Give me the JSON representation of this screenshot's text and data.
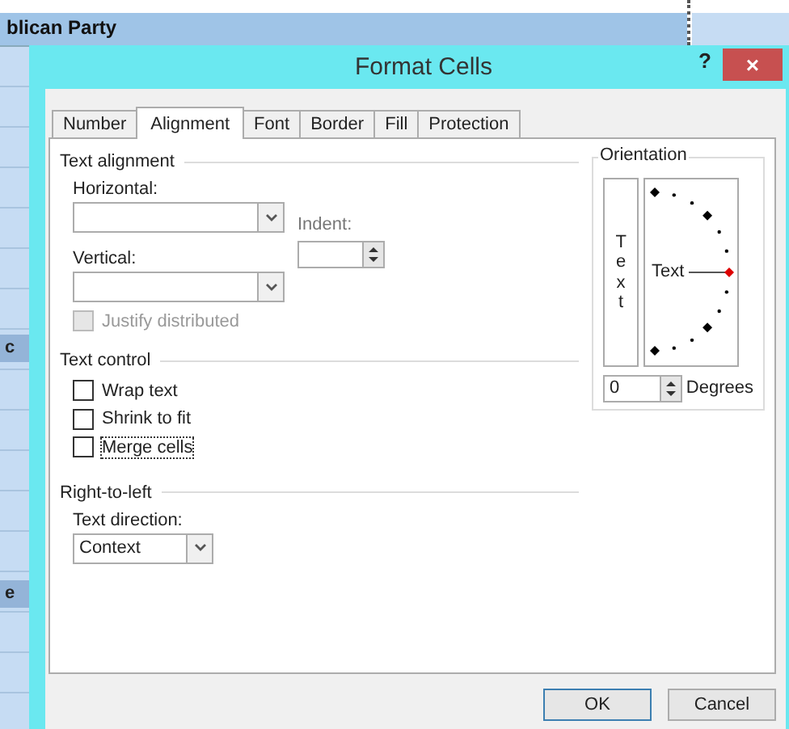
{
  "sheet": {
    "header_cell": "blican Party",
    "side_cells": [
      "c",
      "e"
    ]
  },
  "dialog": {
    "title": "Format Cells",
    "help": "?",
    "close": "×",
    "tabs": [
      {
        "label": "Number",
        "selected": false
      },
      {
        "label": "Alignment",
        "selected": true
      },
      {
        "label": "Font",
        "selected": false
      },
      {
        "label": "Border",
        "selected": false
      },
      {
        "label": "Fill",
        "selected": false
      },
      {
        "label": "Protection",
        "selected": false
      }
    ],
    "text_alignment": {
      "title": "Text alignment",
      "horizontal_label": "Horizontal:",
      "vertical_label": "Vertical:",
      "indent_label": "Indent:",
      "justify_distributed": {
        "label": "Justify distributed",
        "checked": false,
        "disabled": true
      }
    },
    "text_control": {
      "title": "Text control",
      "options": [
        {
          "label": "Wrap text",
          "checked": false,
          "focused": false
        },
        {
          "label": "Shrink to fit",
          "checked": false,
          "focused": false
        },
        {
          "label": "Merge cells",
          "checked": false,
          "focused": true
        }
      ]
    },
    "right_to_left": {
      "title": "Right-to-left",
      "direction_label": "Text direction:",
      "direction_value": "Context"
    },
    "orientation": {
      "title": "Orientation",
      "vertical_text": "Text",
      "dial_text": "Text",
      "degrees_value": "0",
      "degrees_label": "Degrees"
    },
    "buttons": [
      {
        "label": "OK",
        "default": true
      },
      {
        "label": "Cancel",
        "default": false
      }
    ]
  }
}
